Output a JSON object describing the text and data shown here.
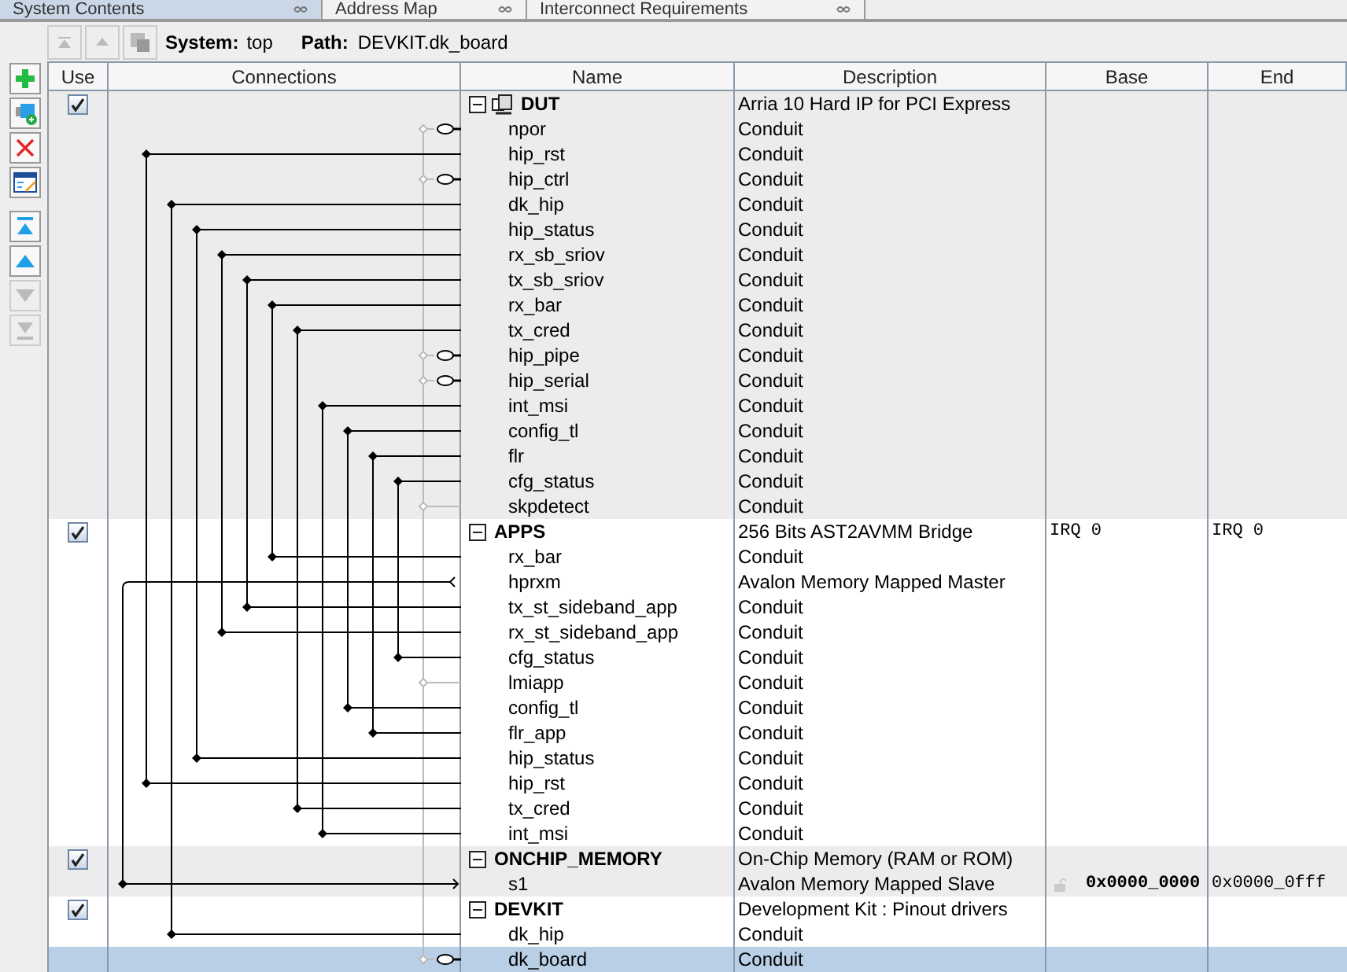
{
  "tabs": [
    {
      "label": "System Contents",
      "selected": true
    },
    {
      "label": "Address Map",
      "selected": false
    },
    {
      "label": "Interconnect Requirements",
      "selected": false
    }
  ],
  "toolbar": {
    "buttons": [
      {
        "kind": "top",
        "disabled": true
      },
      {
        "kind": "up",
        "disabled": true
      },
      {
        "kind": "hierarchy",
        "disabled": true
      }
    ],
    "system_label": "System:",
    "system": "top",
    "path_label": "Path:",
    "path": "DEVKIT.dk_board"
  },
  "side_toolbar": [
    {
      "kind": "add",
      "disabled": false
    },
    {
      "kind": "add-component",
      "disabled": false
    },
    {
      "kind": "remove",
      "disabled": false
    },
    {
      "kind": "edit",
      "disabled": false
    },
    {
      "kind": "move-top",
      "disabled": false
    },
    {
      "kind": "move-up",
      "disabled": false
    },
    {
      "kind": "move-down",
      "disabled": true
    },
    {
      "kind": "move-bottom",
      "disabled": true
    }
  ],
  "table": {
    "columns": [
      "Use",
      "Connections",
      "Name",
      "Description",
      "Base",
      "End"
    ],
    "groups": [
      {
        "name": "DUT",
        "use": true,
        "expanded": true,
        "hierarchical": true,
        "selected": false,
        "description": "Arria 10 Hard IP for PCI Express",
        "ports": [
          {
            "name": "npor",
            "description": "Conduit",
            "exported": true,
            "selected": false
          },
          {
            "name": "hip_rst",
            "description": "Conduit",
            "exported": false,
            "selected": false
          },
          {
            "name": "hip_ctrl",
            "description": "Conduit",
            "exported": true,
            "selected": false
          },
          {
            "name": "dk_hip",
            "description": "Conduit",
            "exported": false,
            "selected": false
          },
          {
            "name": "hip_status",
            "description": "Conduit",
            "exported": false,
            "selected": false
          },
          {
            "name": "rx_sb_sriov",
            "description": "Conduit",
            "exported": false,
            "selected": false
          },
          {
            "name": "tx_sb_sriov",
            "description": "Conduit",
            "exported": false,
            "selected": false
          },
          {
            "name": "rx_bar",
            "description": "Conduit",
            "exported": false,
            "selected": false
          },
          {
            "name": "tx_cred",
            "description": "Conduit",
            "exported": false,
            "selected": false
          },
          {
            "name": "hip_pipe",
            "description": "Conduit",
            "exported": true,
            "selected": false
          },
          {
            "name": "hip_serial",
            "description": "Conduit",
            "exported": true,
            "selected": false
          },
          {
            "name": "int_msi",
            "description": "Conduit",
            "exported": false,
            "selected": false
          },
          {
            "name": "config_tl",
            "description": "Conduit",
            "exported": false,
            "selected": false
          },
          {
            "name": "flr",
            "description": "Conduit",
            "exported": false,
            "selected": false
          },
          {
            "name": "cfg_status",
            "description": "Conduit",
            "exported": false,
            "selected": false
          },
          {
            "name": "skpdetect",
            "description": "Conduit",
            "exported": false,
            "selected": false
          }
        ]
      },
      {
        "name": "APPS",
        "use": true,
        "expanded": true,
        "hierarchical": false,
        "selected": false,
        "description": "256 Bits AST2AVMM Bridge",
        "base": "IRQ 0",
        "end": "IRQ 0",
        "ports": [
          {
            "name": "rx_bar",
            "description": "Conduit",
            "exported": false,
            "selected": false
          },
          {
            "name": "hprxm",
            "description": "Avalon Memory Mapped Master",
            "exported": false,
            "selected": false
          },
          {
            "name": "tx_st_sideband_app",
            "description": "Conduit",
            "exported": false,
            "selected": false
          },
          {
            "name": "rx_st_sideband_app",
            "description": "Conduit",
            "exported": false,
            "selected": false
          },
          {
            "name": "cfg_status",
            "description": "Conduit",
            "exported": false,
            "selected": false
          },
          {
            "name": "lmiapp",
            "description": "Conduit",
            "exported": false,
            "selected": false
          },
          {
            "name": "config_tl",
            "description": "Conduit",
            "exported": false,
            "selected": false
          },
          {
            "name": "flr_app",
            "description": "Conduit",
            "exported": false,
            "selected": false
          },
          {
            "name": "hip_status",
            "description": "Conduit",
            "exported": false,
            "selected": false
          },
          {
            "name": "hip_rst",
            "description": "Conduit",
            "exported": false,
            "selected": false
          },
          {
            "name": "tx_cred",
            "description": "Conduit",
            "exported": false,
            "selected": false
          },
          {
            "name": "int_msi",
            "description": "Conduit",
            "exported": false,
            "selected": false
          }
        ]
      },
      {
        "name": "ONCHIP_MEMORY",
        "use": true,
        "expanded": true,
        "hierarchical": false,
        "selected": false,
        "description": "On-Chip Memory (RAM or ROM)",
        "ports": [
          {
            "name": "s1",
            "description": "Avalon Memory Mapped Slave",
            "exported": false,
            "selected": false,
            "base": "0x0000_0000",
            "end": "0x0000_0fff"
          }
        ]
      },
      {
        "name": "DEVKIT",
        "use": true,
        "expanded": true,
        "hierarchical": false,
        "selected": false,
        "description": "Development Kit : Pinout drivers",
        "ports": [
          {
            "name": "dk_hip",
            "description": "Conduit",
            "exported": false,
            "selected": false
          },
          {
            "name": "dk_board",
            "description": "Conduit",
            "exported": true,
            "selected": true
          }
        ]
      }
    ]
  }
}
